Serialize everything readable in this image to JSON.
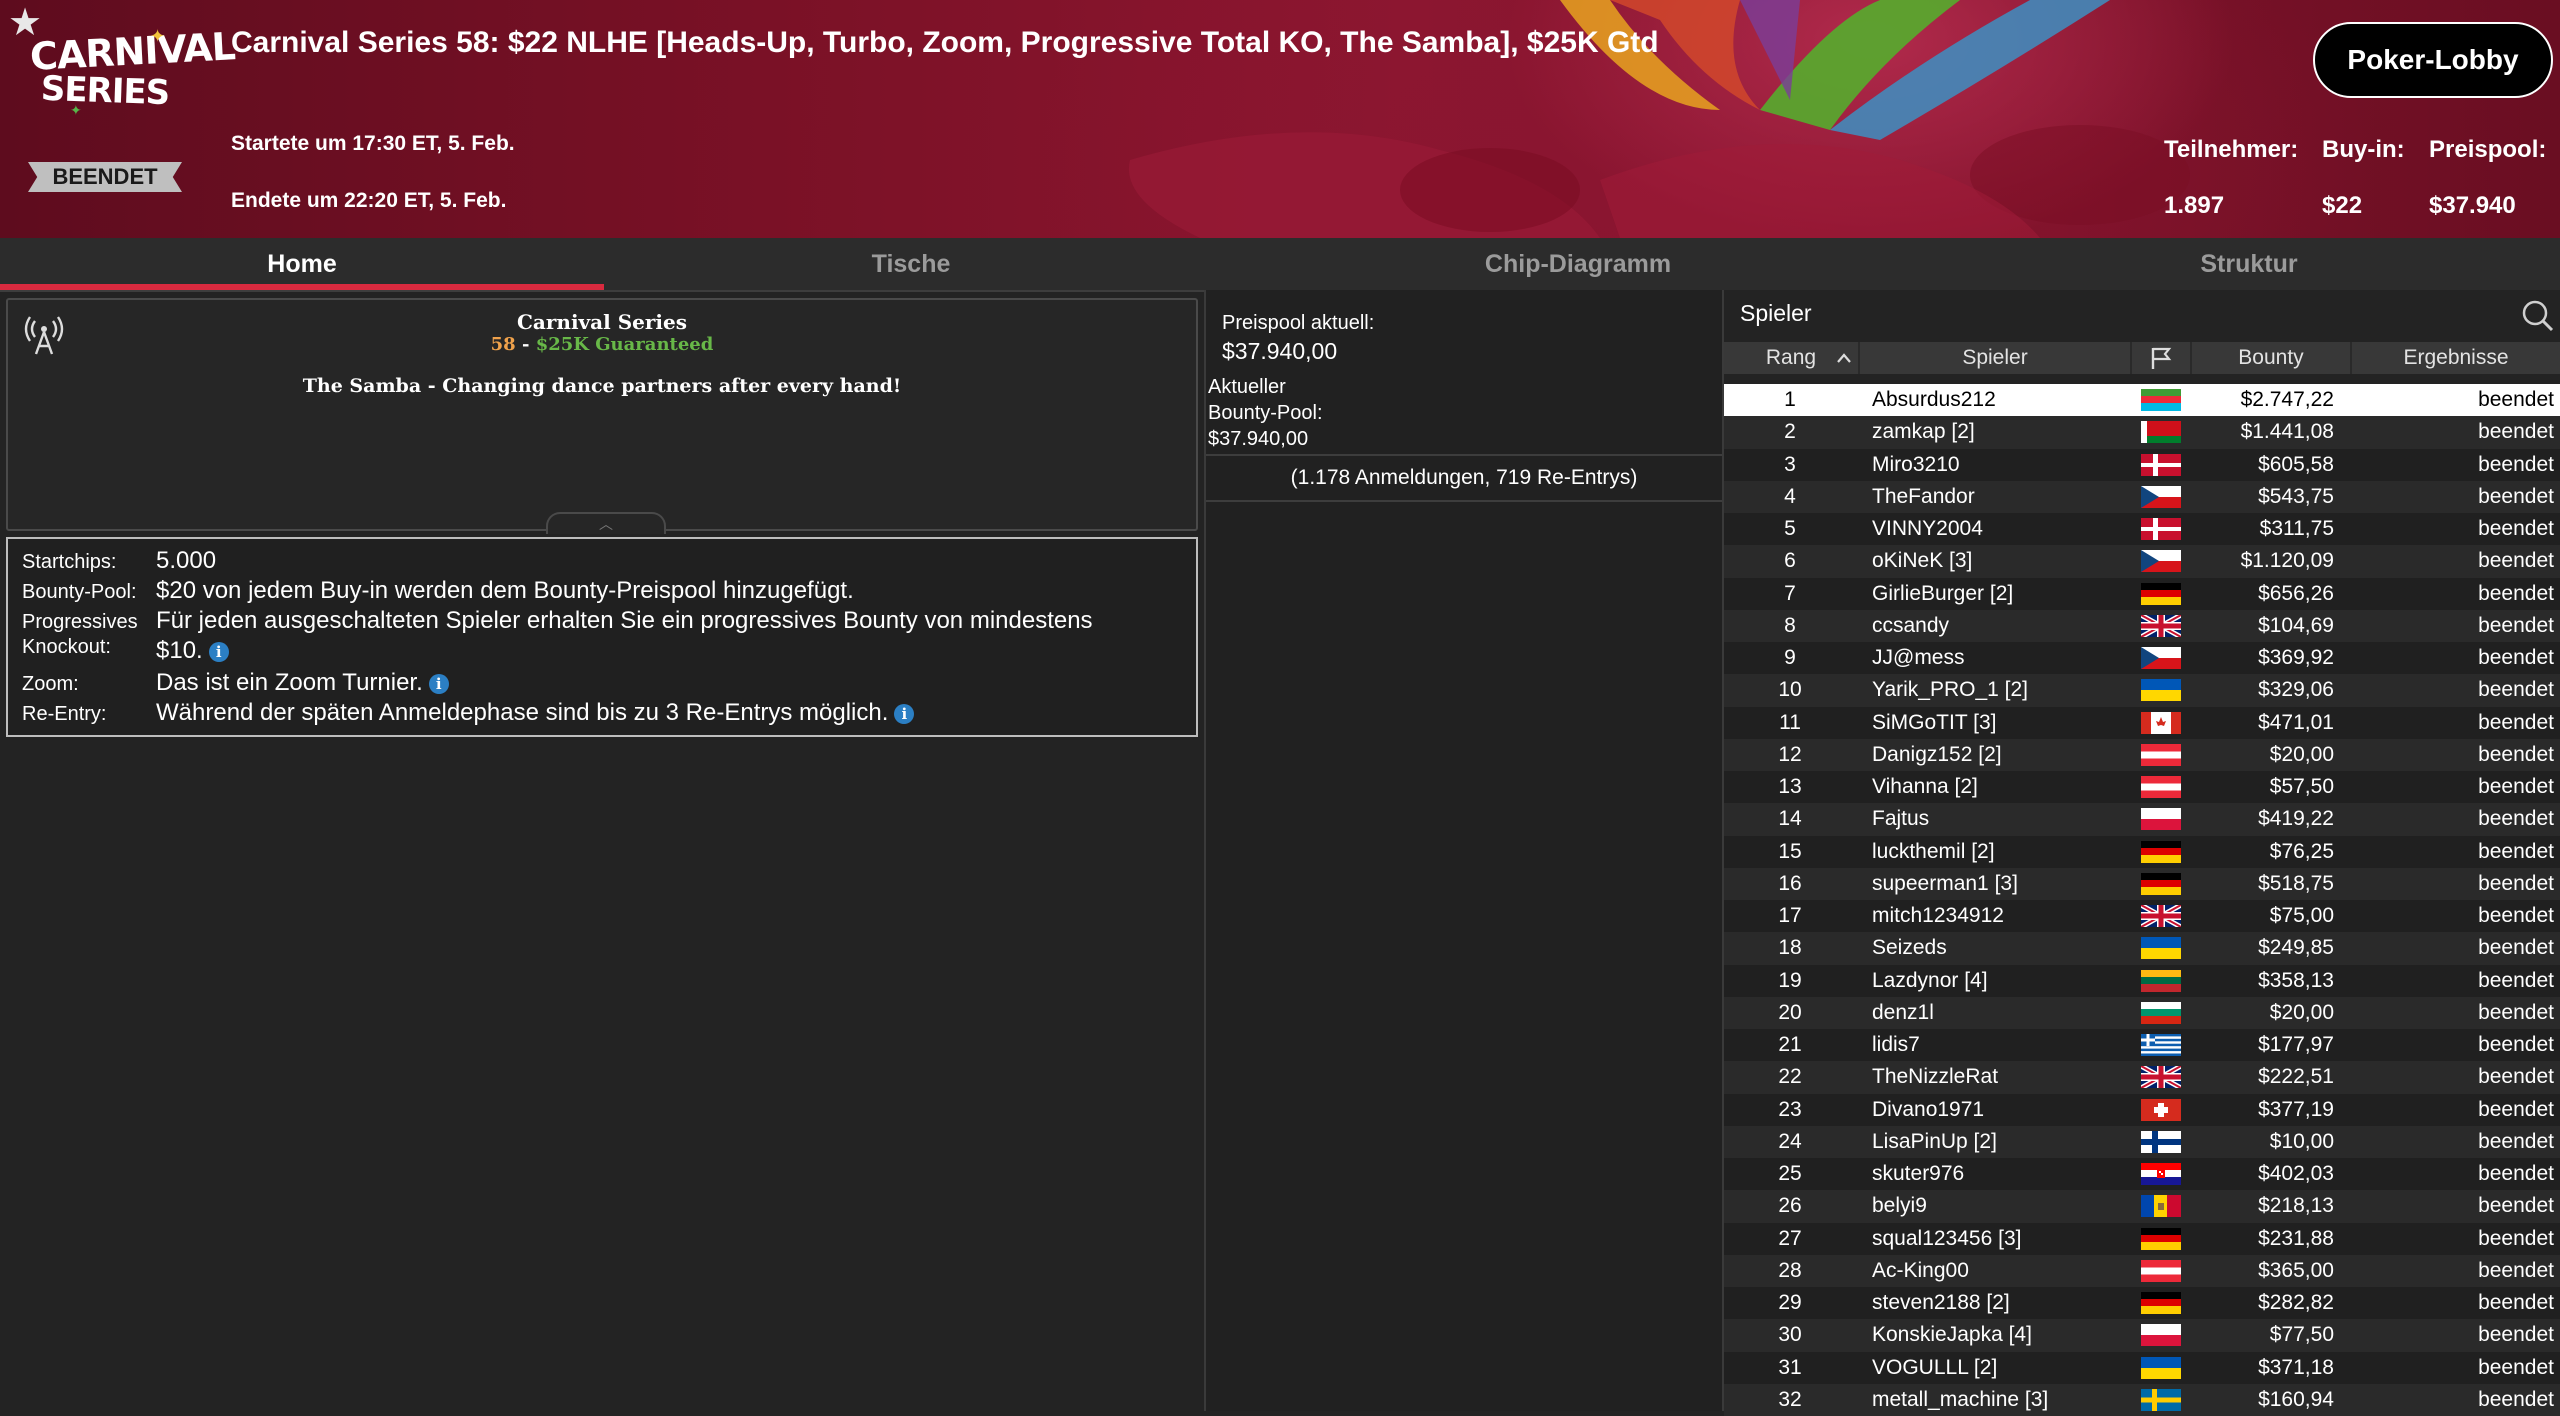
{
  "header": {
    "title": "Carnival Series 58: $22 NLHE [Heads-Up, Turbo, Zoom, Progressive Total KO, The Samba], $25K Gtd",
    "logo_line1": "CARNIVAL",
    "logo_line2": "SERIES",
    "status_badge": "BEENDET",
    "started": "Startete um 17:30 ET, 5. Feb.",
    "ended": "Endete um 22:20 ET, 5. Feb.",
    "lobby_button": "Poker-Lobby",
    "stats": {
      "participants_label": "Teilnehmer:",
      "participants_value": "1.897",
      "buyin_label": "Buy-in:",
      "buyin_value": "$22",
      "prizepool_label": "Preispool:",
      "prizepool_value": "$37.940"
    }
  },
  "tabs": [
    {
      "label": "Home",
      "active": true
    },
    {
      "label": "Tische",
      "active": false
    },
    {
      "label": "Chip-Diagramm",
      "active": false
    },
    {
      "label": "Struktur",
      "active": false
    }
  ],
  "promo": {
    "series": "Carnival Series",
    "number": "58",
    "separator": " - ",
    "guarantee": "$25K Guaranteed",
    "tagline": "The Samba - Changing dance partners after every hand!"
  },
  "info": {
    "startchips_label": "Startchips:",
    "startchips_value": "5.000",
    "bounty_label": "Bounty-Pool:",
    "bounty_value": "$20 von jedem Buy-in werden dem Bounty-Preispool hinzugefügt.",
    "pko_label_1": "Progressives",
    "pko_label_2": "Knockout:",
    "pko_value_1": "Für jeden ausgeschalteten Spieler erhalten Sie ein progressives Bounty von mindestens",
    "pko_value_2": "$10.",
    "zoom_label": "Zoom:",
    "zoom_value": "Das ist ein Zoom Turnier.",
    "reentry_label": "Re-Entry:",
    "reentry_value": "Während der späten Anmeldephase sind bis zu 3 Re-Entrys möglich."
  },
  "prize": {
    "current_label": "Preispool aktuell:",
    "current_value": "$37.940,00",
    "bounty_label_1": "Aktueller",
    "bounty_label_2": "Bounty-Pool:",
    "bounty_value": "$37.940,00",
    "entries": "(1.178 Anmeldungen, 719 Re-Entrys)"
  },
  "players": {
    "search_label": "Spieler",
    "columns": {
      "rank": "Rang",
      "player": "Spieler",
      "bounty": "Bounty",
      "result": "Ergebnisse"
    },
    "rows": [
      {
        "rank": "1",
        "name": "Absurdus212",
        "flag": "az",
        "bounty": "$2.747,22",
        "result": "beendet"
      },
      {
        "rank": "2",
        "name": "zamkap [2]",
        "flag": "by",
        "bounty": "$1.441,08",
        "result": "beendet"
      },
      {
        "rank": "3",
        "name": "Miro3210",
        "flag": "dk",
        "bounty": "$605,58",
        "result": "beendet"
      },
      {
        "rank": "4",
        "name": "TheFandor",
        "flag": "cz",
        "bounty": "$543,75",
        "result": "beendet"
      },
      {
        "rank": "5",
        "name": "VINNY2004",
        "flag": "dk",
        "bounty": "$311,75",
        "result": "beendet"
      },
      {
        "rank": "6",
        "name": "oKiNeK [3]",
        "flag": "cz",
        "bounty": "$1.120,09",
        "result": "beendet"
      },
      {
        "rank": "7",
        "name": "GirlieBurger [2]",
        "flag": "de",
        "bounty": "$656,26",
        "result": "beendet"
      },
      {
        "rank": "8",
        "name": "ccsandy",
        "flag": "gb",
        "bounty": "$104,69",
        "result": "beendet"
      },
      {
        "rank": "9",
        "name": "JJ@mess",
        "flag": "cz",
        "bounty": "$369,92",
        "result": "beendet"
      },
      {
        "rank": "10",
        "name": "Yarik_PRO_1 [2]",
        "flag": "ua",
        "bounty": "$329,06",
        "result": "beendet"
      },
      {
        "rank": "11",
        "name": "SiMGoTIT [3]",
        "flag": "ca",
        "bounty": "$471,01",
        "result": "beendet"
      },
      {
        "rank": "12",
        "name": "Danigz152 [2]",
        "flag": "at",
        "bounty": "$20,00",
        "result": "beendet"
      },
      {
        "rank": "13",
        "name": "Vihanna [2]",
        "flag": "at",
        "bounty": "$57,50",
        "result": "beendet"
      },
      {
        "rank": "14",
        "name": "Fajtus",
        "flag": "pl",
        "bounty": "$419,22",
        "result": "beendet"
      },
      {
        "rank": "15",
        "name": "luckthemil [2]",
        "flag": "de",
        "bounty": "$76,25",
        "result": "beendet"
      },
      {
        "rank": "16",
        "name": "supeerman1 [3]",
        "flag": "de",
        "bounty": "$518,75",
        "result": "beendet"
      },
      {
        "rank": "17",
        "name": "mitch1234912",
        "flag": "gb",
        "bounty": "$75,00",
        "result": "beendet"
      },
      {
        "rank": "18",
        "name": "Seizeds",
        "flag": "ua",
        "bounty": "$249,85",
        "result": "beendet"
      },
      {
        "rank": "19",
        "name": "Lazdynor [4]",
        "flag": "lt",
        "bounty": "$358,13",
        "result": "beendet"
      },
      {
        "rank": "20",
        "name": "denz1l",
        "flag": "bg",
        "bounty": "$20,00",
        "result": "beendet"
      },
      {
        "rank": "21",
        "name": "lidis7",
        "flag": "gr",
        "bounty": "$177,97",
        "result": "beendet"
      },
      {
        "rank": "22",
        "name": "TheNizzleRat",
        "flag": "gb",
        "bounty": "$222,51",
        "result": "beendet"
      },
      {
        "rank": "23",
        "name": "Divano1971",
        "flag": "ch",
        "bounty": "$377,19",
        "result": "beendet"
      },
      {
        "rank": "24",
        "name": "LisaPinUp [2]",
        "flag": "fi",
        "bounty": "$10,00",
        "result": "beendet"
      },
      {
        "rank": "25",
        "name": "skuter976",
        "flag": "hr",
        "bounty": "$402,03",
        "result": "beendet"
      },
      {
        "rank": "26",
        "name": "belyi9",
        "flag": "md",
        "bounty": "$218,13",
        "result": "beendet"
      },
      {
        "rank": "27",
        "name": "squal123456 [3]",
        "flag": "de",
        "bounty": "$231,88",
        "result": "beendet"
      },
      {
        "rank": "28",
        "name": "Ac-King00",
        "flag": "at",
        "bounty": "$365,00",
        "result": "beendet"
      },
      {
        "rank": "29",
        "name": "steven2188 [2]",
        "flag": "de",
        "bounty": "$282,82",
        "result": "beendet"
      },
      {
        "rank": "30",
        "name": "KonskieJapka [4]",
        "flag": "pl",
        "bounty": "$77,50",
        "result": "beendet"
      },
      {
        "rank": "31",
        "name": "VOGULLL [2]",
        "flag": "ua",
        "bounty": "$371,18",
        "result": "beendet"
      },
      {
        "rank": "32",
        "name": "metall_machine [3]",
        "flag": "se",
        "bounty": "$160,94",
        "result": "beendet"
      }
    ]
  }
}
